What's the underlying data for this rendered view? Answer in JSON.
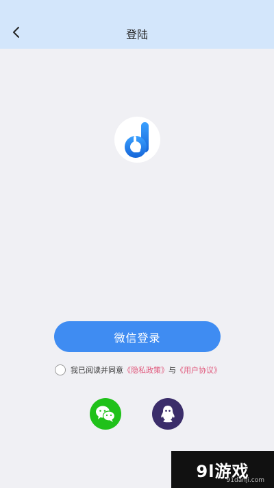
{
  "header": {
    "title": "登陆",
    "back_icon": "chevron-left-icon"
  },
  "logo": {
    "icon": "app-logo-icon",
    "color": "#1a73e8"
  },
  "login": {
    "wechat_button_label": "微信登录"
  },
  "agreement": {
    "prefix": "我已阅读并同意",
    "privacy_link": "《隐私政策》",
    "connector": "与",
    "terms_link": "《用户协议》"
  },
  "social": [
    {
      "name": "wechat",
      "icon": "wechat-icon",
      "color": "#20c11a"
    },
    {
      "name": "qq",
      "icon": "qq-icon",
      "color": "#3b2d6a"
    }
  ],
  "watermark": {
    "text": "9l游戏",
    "sub": "91danji.com"
  },
  "colors": {
    "accent": "#3f8cf2",
    "link": "#e0567a",
    "header_bg": "#d3e6fb"
  }
}
